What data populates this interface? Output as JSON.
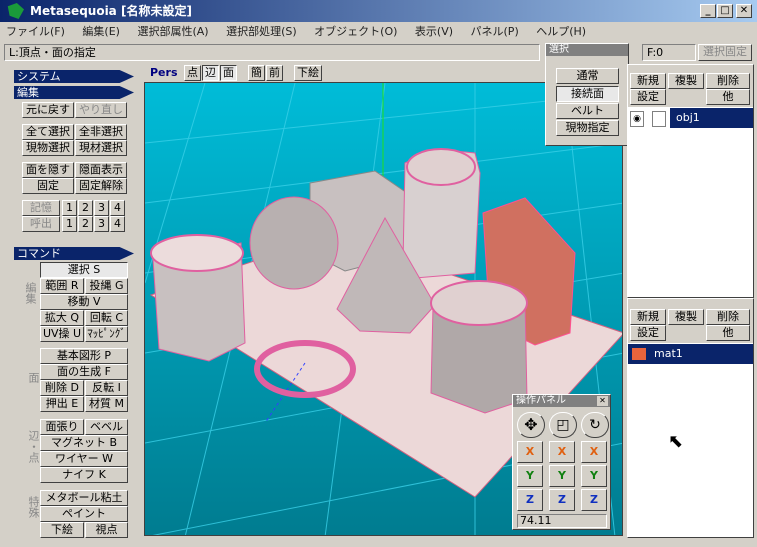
{
  "window": {
    "title": "Metasequoia [名称未設定]"
  },
  "menu": [
    "ファイル(F)",
    "編集(E)",
    "選択部属性(A)",
    "選択部処理(S)",
    "オブジェクト(O)",
    "表示(V)",
    "パネル(P)",
    "ヘルプ(H)"
  ],
  "status": {
    "text": "L:頂点・面の指定",
    "frame": "F:0",
    "fixed_label": "選択固定"
  },
  "left": {
    "system_header": "システム",
    "edit_header": "編集",
    "undo": "元に戻す",
    "redo": "やり直し",
    "select_all": "全て選択",
    "deselect_all": "全非選択",
    "cur_select": "現物選択",
    "mat_select": "現材選択",
    "hide_face": "面を隠す",
    "show_hidden": "隠面表示",
    "fix": "固定",
    "unfix": "固定解除",
    "memory": "記憶",
    "recall": "呼出",
    "slots": [
      "1",
      "2",
      "3",
      "4"
    ],
    "command_header": "コマンド",
    "group_edit": "編集",
    "group_face": "面",
    "group_edge": "辺・点",
    "group_special": "特殊",
    "select": "選択 S",
    "range": "範囲 R",
    "lasso": "投縄 G",
    "move": "移動 V",
    "scale": "拡大 Q",
    "rotate": "回転 C",
    "uv": "UV操 U",
    "mapping": "ﾏｯﾋﾟﾝｸﾞ",
    "basic_shape": "基本図形 P",
    "create_face": "面の生成 F",
    "delete": "削除 D",
    "flip": "反転 I",
    "extrude": "押出 E",
    "material": "材質 M",
    "stretch": "面張り",
    "bevel": "ベベル",
    "magnet": "マグネット B",
    "wire": "ワイヤー W",
    "knife": "ナイフ K",
    "metaball": "メタボール粘土",
    "paint": "ペイント",
    "underlay": "下絵",
    "viewpoint": "視点"
  },
  "viewport": {
    "mode": "Pers",
    "buttons": [
      "点",
      "辺",
      "面",
      "簡",
      "前",
      "下絵"
    ]
  },
  "select_panel": {
    "title": "選択",
    "items": [
      "通常",
      "接続面",
      "ベルト",
      "現物指定"
    ]
  },
  "object_panel": {
    "new": "新規",
    "copy": "複製",
    "delete": "削除",
    "settings": "設定",
    "other": "他",
    "items": [
      "obj1"
    ]
  },
  "material_panel": {
    "new": "新規",
    "copy": "複製",
    "delete": "削除",
    "settings": "設定",
    "other": "他",
    "items": [
      "mat1"
    ],
    "mat_color": "#e8643c"
  },
  "ops_panel": {
    "title": "操作パネル",
    "x": "X",
    "y": "Y",
    "z": "Z",
    "value": "74.11"
  }
}
